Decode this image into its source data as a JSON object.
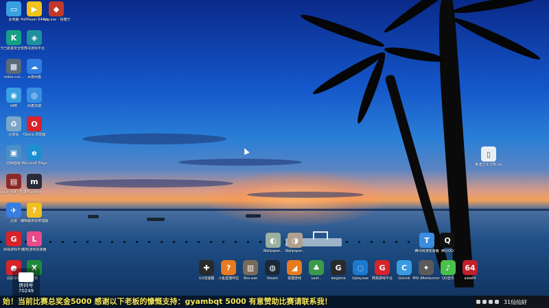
{
  "desktop_icons": [
    {
      "name": "this-pc-icon",
      "label": "此电脑",
      "glyph": "▭",
      "color": "#3aa0e0"
    },
    {
      "name": "potplayer-icon",
      "label": "PotPlayer 64 bit",
      "glyph": "▶",
      "color": "#f2c21b"
    },
    {
      "name": "rpg-icon",
      "label": "Rpg.exe - 快捷方式",
      "glyph": "◆",
      "color": "#c0392b"
    },
    {
      "name": "security-icon",
      "label": "卡巴斯基安全软件",
      "glyph": "K",
      "color": "#15a085"
    },
    {
      "name": "game-platform-icon",
      "label": "方块游戏平台",
      "glyph": "◈",
      "color": "#1f8fa0"
    },
    {
      "name": "video-tool-icon",
      "label": "video-cut...",
      "glyph": "▦",
      "color": "#5a6a7a"
    },
    {
      "name": "baidu-netdisk-icon",
      "label": "百度网盘",
      "glyph": "☁",
      "color": "#2f7de0"
    },
    {
      "name": "network-icon",
      "label": "网络",
      "glyph": "◉",
      "color": "#3aa0e0"
    },
    {
      "name": "browser-icon",
      "label": "网盘加速",
      "glyph": "◎",
      "color": "#3a8ee0"
    },
    {
      "name": "recycle-bin-icon",
      "label": "回收站",
      "glyph": "♻",
      "color": "#7aa6c8"
    },
    {
      "name": "opera-icon",
      "label": "Opera 浏览器",
      "glyph": "O",
      "color": "#d8232a"
    },
    {
      "name": "control-panel-icon",
      "label": "控制面板",
      "glyph": "▣",
      "color": "#4a90c8"
    },
    {
      "name": "edge-icon",
      "label": "Microsoft Edge",
      "glyph": "e",
      "color": "#1b8fd0"
    },
    {
      "name": "cpuz-icon",
      "label": "cpuz_x64 - 快捷方式",
      "glyph": "▤",
      "color": "#8a2a2a"
    },
    {
      "name": "maxthon-icon",
      "label": "Maxthon",
      "glyph": "m",
      "color": "#2a2a3a"
    },
    {
      "name": "feishu-icon",
      "label": "迅雷",
      "glyph": "✈",
      "color": "#3a7de0"
    },
    {
      "name": "help-icon",
      "label": "编辑器资源管理器",
      "glyph": "?",
      "color": "#f0c020"
    },
    {
      "name": "game-client-icon",
      "label": "网易游戏平台",
      "glyph": "G",
      "color": "#d8232a"
    },
    {
      "name": "lala-icon",
      "label": "啦啦游戏加速器",
      "glyph": "L",
      "color": "#e84a8a"
    },
    {
      "name": "record-icon",
      "label": "白屏录制",
      "glyph": "●",
      "color": "#d8232a"
    },
    {
      "name": "xls-icon",
      "label": "表格",
      "glyph": "X",
      "color": "#1f8a3a"
    }
  ],
  "right_icons": [
    {
      "name": "text-doc-icon",
      "label": "新建文本文档.txt",
      "glyph": "▯",
      "color": "#e8eef4"
    },
    {
      "name": "tencent-game-icon",
      "label": "腾讯网游加速器",
      "glyph": "T",
      "color": "#3a8ee0"
    },
    {
      "name": "qq-icon",
      "label": "腾讯QQ",
      "glyph": "Q",
      "color": "#111111"
    }
  ],
  "center_icons": [
    {
      "name": "wallpaper-file-icon",
      "label": "Wallpaper...",
      "glyph": "◐",
      "color": "#9ab0a0"
    },
    {
      "name": "wallpaper-file2-icon",
      "label": "Wallpaper...",
      "glyph": "◑",
      "color": "#b0a090"
    }
  ],
  "dock": [
    {
      "name": "controller-icon",
      "label": "UU加速器",
      "glyph": "✚",
      "color": "#2a2a2a"
    },
    {
      "name": "game-center-icon",
      "label": "斗鱼直播伴侣",
      "glyph": "?",
      "color": "#e87a20"
    },
    {
      "name": "box-icon",
      "label": "Box.exe",
      "glyph": "▥",
      "color": "#7a6a5a"
    },
    {
      "name": "steam-icon",
      "label": "Steam",
      "glyph": "◍",
      "color": "#1b2838"
    },
    {
      "name": "fox-icon",
      "label": "狐狸游戏",
      "glyph": "◢",
      "color": "#e87a20"
    },
    {
      "name": "tree-icon",
      "label": "Leaf...",
      "glyph": "♣",
      "color": "#3a9a4a"
    },
    {
      "name": "wegame-icon",
      "label": "wegame",
      "glyph": "G",
      "color": "#2a2a2a"
    },
    {
      "name": "uplay-icon",
      "label": "Uplay.exe",
      "glyph": "◌",
      "color": "#1b7ad0"
    },
    {
      "name": "netease-icon",
      "label": "网易游戏平台",
      "glyph": "G",
      "color": "#d8232a"
    },
    {
      "name": "golink-icon",
      "label": "GoLink",
      "glyph": "C",
      "color": "#3a9ae0"
    },
    {
      "name": "msi-icon",
      "label": "MSI Afterburner",
      "glyph": "✦",
      "color": "#5a5a5a"
    },
    {
      "name": "qq-music-icon",
      "label": "QQ音乐",
      "glyph": "♪",
      "color": "#4ac04a"
    },
    {
      "name": "aida64-icon",
      "label": "aida64",
      "glyph": "64",
      "color": "#c0202a"
    }
  ],
  "room": {
    "platform": "房间号",
    "number": "70249"
  },
  "ticker": "始！当前比赛总奖金5000  感谢以下老板的慷慨支持：gyambqt 5000   有意赞助比赛请联系我！",
  "tray": {
    "clock": "31仙仙好"
  }
}
